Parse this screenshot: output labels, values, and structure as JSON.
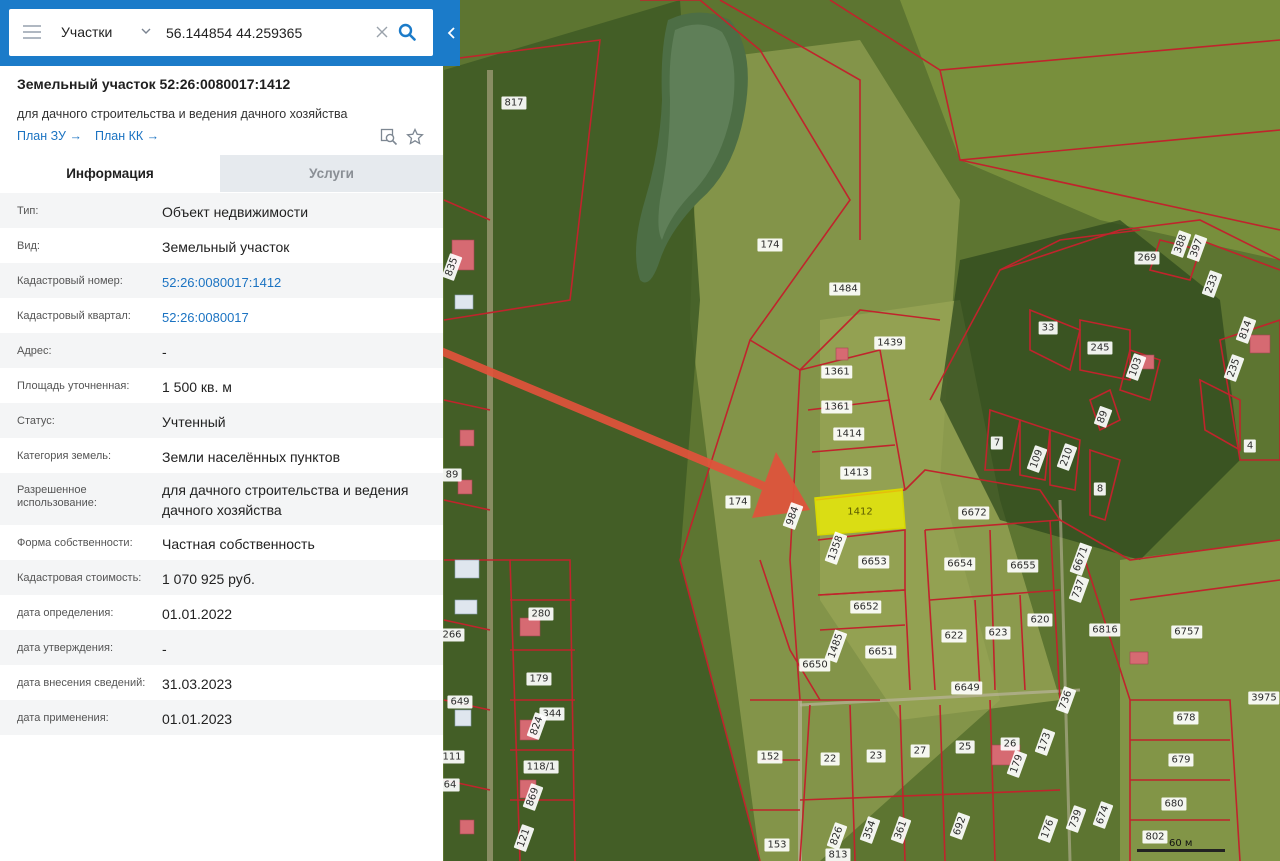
{
  "search": {
    "category": "Участки",
    "query": "56.144854 44.259365"
  },
  "parcel": {
    "title": "Земельный участок 52:26:0080017:1412",
    "purpose": "для дачного строительства и ведения дачного хозяйства",
    "plan_zu_label": "План ЗУ",
    "plan_kk_label": "План КК"
  },
  "tabs": {
    "info": "Информация",
    "services": "Услуги"
  },
  "properties": [
    {
      "label": "Тип:",
      "value": "Объект недвижимости"
    },
    {
      "label": "Вид:",
      "value": "Земельный участок"
    },
    {
      "label": "Кадастровый номер:",
      "value": "52:26:0080017:1412"
    },
    {
      "label": "Кадастровый квартал:",
      "value": "52:26:0080017"
    },
    {
      "label": "Адрес:",
      "value": "-"
    },
    {
      "label": "Площадь уточненная:",
      "value": "1 500 кв. м"
    },
    {
      "label": "Статус:",
      "value": "Учтенный"
    },
    {
      "label": "Категория земель:",
      "value": "Земли населённых пунктов"
    },
    {
      "label": "Разрешенное использование:",
      "value": "для дачного строительства и ведения дачного хозяйства"
    },
    {
      "label": "Форма собственности:",
      "value": "Частная собственность"
    },
    {
      "label": "Кадастровая стоимость:",
      "value": "1 070 925 руб."
    },
    {
      "label": "дата определения:",
      "value": "01.01.2022"
    },
    {
      "label": "дата утверждения:",
      "value": "-"
    },
    {
      "label": "дата внесения сведений:",
      "value": "31.03.2023"
    },
    {
      "label": "дата применения:",
      "value": "01.01.2023"
    }
  ],
  "map": {
    "scale_label": "60 м",
    "selected_plot": "1412",
    "plots": [
      "817",
      "174",
      "1484",
      "1439",
      "1361",
      "1361",
      "1414",
      "1413",
      "1412",
      "174",
      "984",
      "1358",
      "6653",
      "6652",
      "6651",
      "1485",
      "6650",
      "6672",
      "6654",
      "6655",
      "6671",
      "737",
      "6816",
      "6757",
      "622",
      "623",
      "620",
      "6649",
      "736",
      "678",
      "679",
      "680",
      "3975",
      "152",
      "22",
      "23",
      "27",
      "25",
      "26",
      "179",
      "173",
      "153",
      "826",
      "813",
      "354",
      "361",
      "692",
      "176",
      "739",
      "674",
      "802",
      "33",
      "245",
      "103",
      "269",
      "388",
      "397",
      "233",
      "814",
      "235",
      "4",
      "7",
      "109",
      "210",
      "8",
      "89",
      "835",
      "266",
      "649",
      "280",
      "179",
      "344",
      "118/1",
      "824",
      "869",
      "121",
      "111",
      "64",
      "89"
    ]
  },
  "colors": {
    "brand": "#1b7bc9",
    "link": "#1b73c2",
    "arrow": "#e0533b",
    "boundary": "#c0242c",
    "selected_fill": "#f2f200"
  }
}
